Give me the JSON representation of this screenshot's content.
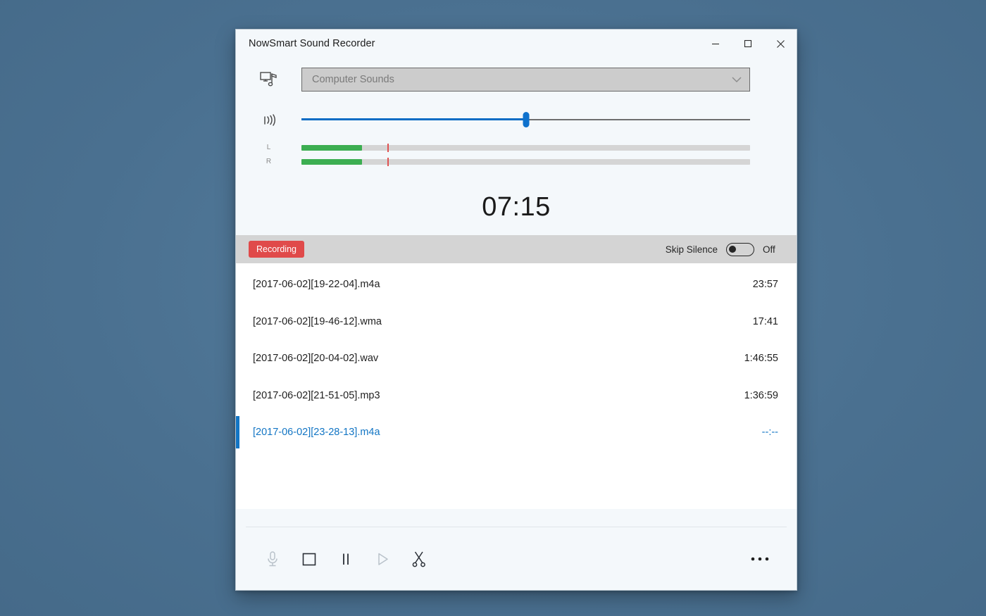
{
  "window": {
    "title": "NowSmart Sound Recorder",
    "controls": {
      "minimize": "minimize-button",
      "maximize": "maximize-button",
      "close": "close-button"
    }
  },
  "source": {
    "icon": "computer-sounds-icon",
    "value": "Computer Sounds",
    "placeholder": "Computer Sounds",
    "chevron": "chevron-down-icon"
  },
  "volume": {
    "icon": "volume-waves-icon",
    "value": 50
  },
  "meters": {
    "left_label": "L",
    "right_label": "R",
    "left_level": 13.5,
    "right_level": 13.5,
    "left_peak": 19.2,
    "right_peak": 19.2,
    "fill_color": "#3cae51",
    "peak_color": "#e05252",
    "track_color": "#d5d5d5"
  },
  "timer": {
    "elapsed": "07:15"
  },
  "status": {
    "recording_label": "Recording",
    "recording_color": "#e04a4a",
    "skip_silence_label": "Skip Silence",
    "skip_silence_state": "Off",
    "skip_silence_on": false
  },
  "files": {
    "items": [
      {
        "name": "[2017-06-02][19-22-04].m4a",
        "duration": "23:57",
        "selected": false
      },
      {
        "name": "[2017-06-02][19-46-12].wma",
        "duration": "17:41",
        "selected": false
      },
      {
        "name": "[2017-06-02][20-04-02].wav",
        "duration": "1:46:55",
        "selected": false
      },
      {
        "name": "[2017-06-02][21-51-05].mp3",
        "duration": "1:36:59",
        "selected": false
      },
      {
        "name": "[2017-06-02][23-28-13].m4a",
        "duration": "--:--",
        "selected": true
      }
    ],
    "selected_color": "#1275c4"
  },
  "toolbar": {
    "record": "record-button",
    "stop": "stop-button",
    "pause": "pause-button",
    "play": "play-button",
    "trim": "trim-button",
    "more": "more-options-button",
    "enabled_color": "#2a2f36",
    "disabled_color": "#b9c2ca"
  }
}
